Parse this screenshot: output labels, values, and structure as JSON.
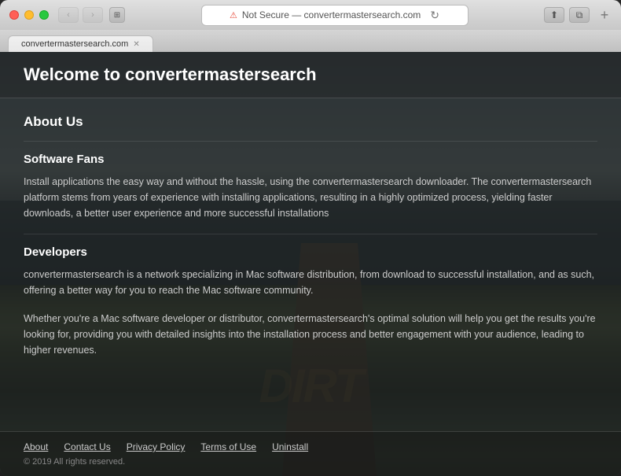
{
  "window": {
    "title": "Not Secure — convertermastersearch.com",
    "tab_label": "convertermastersearch.com"
  },
  "browser": {
    "address": "Not Secure — convertermastersearch.com",
    "back_disabled": true,
    "forward_disabled": true
  },
  "site": {
    "header": {
      "title": "Welcome to convertermastersearch"
    },
    "sections": [
      {
        "heading": "About Us"
      },
      {
        "subheading": "Software Fans",
        "body": "Install applications the easy way and without the hassle, using the convertermastersearch downloader. The convertermastersearch platform stems from years of experience with installing applications, resulting in a highly optimized process, yielding faster downloads, a better user experience and more successful installations"
      },
      {
        "subheading": "Developers",
        "body1": "convertermastersearch is a network specializing in Mac software distribution, from download to successful installation, and as such, offering a better way for you to reach the Mac software community.",
        "body2": "Whether you're a Mac software developer or distributor, convertermastersearch's optimal solution will help you get the results you're looking for, providing you with detailed insights into the installation process and better engagement with your audience, leading to higher revenues."
      }
    ],
    "footer": {
      "links": [
        {
          "label": "About"
        },
        {
          "label": "Contact Us"
        },
        {
          "label": "Privacy Policy"
        },
        {
          "label": "Terms of Use"
        },
        {
          "label": "Uninstall"
        }
      ],
      "copyright": "© 2019 All rights reserved."
    }
  },
  "watermark": {
    "text": "DIRT"
  }
}
